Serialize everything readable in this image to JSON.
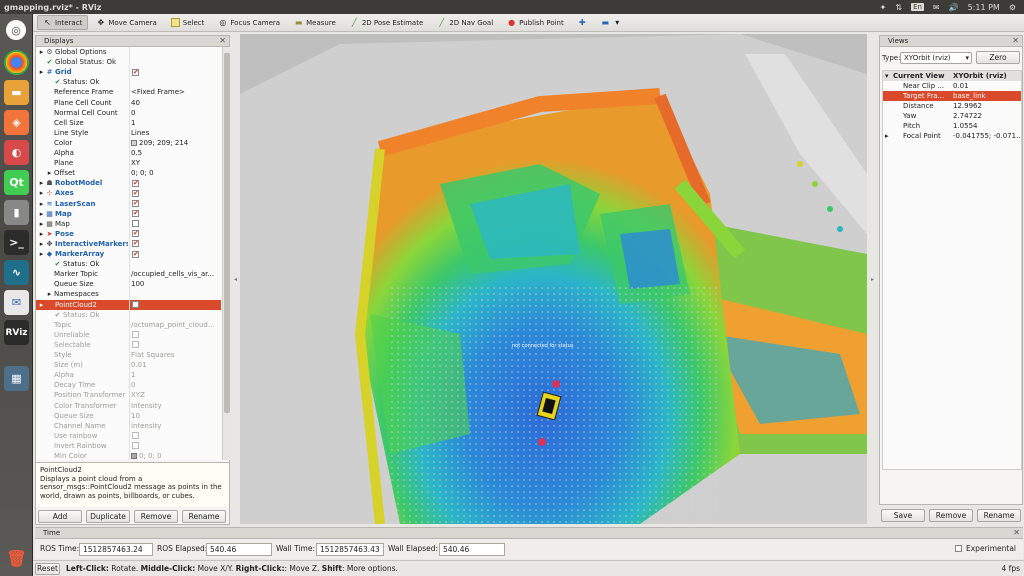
{
  "window": {
    "title": "gmapping.rviz* - RViz"
  },
  "tray": {
    "keyboard": "En",
    "clock": "5:11 PM"
  },
  "launcher": {
    "qt_label": "Qt",
    "rviz_label": "RViz"
  },
  "toolbar": {
    "tools": [
      {
        "label": "Interact",
        "icon": "interact-icon"
      },
      {
        "label": "Move Camera",
        "icon": "move-camera-icon"
      },
      {
        "label": "Select",
        "icon": "select-icon"
      },
      {
        "label": "Focus Camera",
        "icon": "focus-camera-icon"
      },
      {
        "label": "Measure",
        "icon": "measure-icon"
      },
      {
        "label": "2D Pose Estimate",
        "icon": "pose-estimate-icon"
      },
      {
        "label": "2D Nav Goal",
        "icon": "nav-goal-icon"
      },
      {
        "label": "Publish Point",
        "icon": "publish-point-icon"
      }
    ]
  },
  "displays": {
    "title": "Displays",
    "rows": [
      {
        "label": "Global Options",
        "value": ""
      },
      {
        "label": "Global Status: Ok",
        "value": ""
      },
      {
        "label": "Grid",
        "value": ""
      },
      {
        "label": "Status: Ok",
        "value": ""
      },
      {
        "label": "Reference Frame",
        "value": "<Fixed Frame>"
      },
      {
        "label": "Plane Cell Count",
        "value": "40"
      },
      {
        "label": "Normal Cell Count",
        "value": "0"
      },
      {
        "label": "Cell Size",
        "value": "1"
      },
      {
        "label": "Line Style",
        "value": "Lines"
      },
      {
        "label": "Color",
        "value": "209; 209; 214"
      },
      {
        "label": "Alpha",
        "value": "0.5"
      },
      {
        "label": "Plane",
        "value": "XY"
      },
      {
        "label": "Offset",
        "value": "0; 0; 0"
      },
      {
        "label": "RobotModel",
        "value": ""
      },
      {
        "label": "Axes",
        "value": ""
      },
      {
        "label": "LaserScan",
        "value": ""
      },
      {
        "label": "Map",
        "value": ""
      },
      {
        "label": "Map",
        "value": ""
      },
      {
        "label": "Pose",
        "value": ""
      },
      {
        "label": "InteractiveMarkers",
        "value": ""
      },
      {
        "label": "MarkerArray",
        "value": ""
      },
      {
        "label": "Status: Ok",
        "value": ""
      },
      {
        "label": "Marker Topic",
        "value": "/occupied_cells_vis_ar..."
      },
      {
        "label": "Queue Size",
        "value": "100"
      },
      {
        "label": "Namespaces",
        "value": ""
      },
      {
        "label": "PointCloud2",
        "value": ""
      },
      {
        "label": "Status: Ok",
        "value": ""
      },
      {
        "label": "Topic",
        "value": "/octomap_point_cloud..."
      },
      {
        "label": "Unreliable",
        "value": ""
      },
      {
        "label": "Selectable",
        "value": ""
      },
      {
        "label": "Style",
        "value": "Flat Squares"
      },
      {
        "label": "Size (m)",
        "value": "0.01"
      },
      {
        "label": "Alpha",
        "value": "1"
      },
      {
        "label": "Decay Time",
        "value": "0"
      },
      {
        "label": "Position Transformer",
        "value": "XYZ"
      },
      {
        "label": "Color Transformer",
        "value": "Intensity"
      },
      {
        "label": "Queue Size",
        "value": "10"
      },
      {
        "label": "Channel Name",
        "value": "intensity"
      },
      {
        "label": "Use rainbow",
        "value": ""
      },
      {
        "label": "Invert Rainbow",
        "value": ""
      },
      {
        "label": "Min Color",
        "value": "0; 0; 0"
      }
    ],
    "help_title": "PointCloud2",
    "help_text": "Displays a point cloud from a sensor_msgs::PointCloud2 message as points in the world, drawn as points, billboards, or cubes.",
    "buttons": {
      "add": "Add",
      "duplicate": "Duplicate",
      "remove": "Remove",
      "rename": "Rename"
    }
  },
  "viewport": {
    "overlay_text": "not connected for status"
  },
  "views": {
    "title": "Views",
    "type_label": "Type:",
    "type_value": "XYOrbit (rviz)",
    "zero_label": "Zero",
    "rows": [
      {
        "label": "Current View",
        "value": "XYOrbit (rviz)"
      },
      {
        "label": "Near Clip ...",
        "value": "0.01"
      },
      {
        "label": "Target Fra...",
        "value": "base_link"
      },
      {
        "label": "Distance",
        "value": "12.9962"
      },
      {
        "label": "Yaw",
        "value": "2.74722"
      },
      {
        "label": "Pitch",
        "value": "1.0554"
      },
      {
        "label": "Focal Point",
        "value": "-0.041755; -0.071..."
      }
    ],
    "buttons": {
      "save": "Save",
      "remove": "Remove",
      "rename": "Rename"
    }
  },
  "time": {
    "title": "Time",
    "ros_time_label": "ROS Time:",
    "ros_time": "1512857463.24",
    "ros_elapsed_label": "ROS Elapsed:",
    "ros_elapsed": "540.46",
    "wall_time_label": "Wall Time:",
    "wall_time": "1512857463.43",
    "wall_elapsed_label": "Wall Elapsed:",
    "wall_elapsed": "540.46",
    "experimental_label": "Experimental"
  },
  "statusbar": {
    "reset_label": "Reset",
    "hint_left_click": "Left-Click:",
    "hint_left_text": " Rotate. ",
    "hint_middle_click": "Middle-Click:",
    "hint_middle_text": " Move X/Y. ",
    "hint_right_click": "Right-Click:",
    "hint_right_text": ": Move Z. ",
    "hint_shift": "Shift",
    "hint_shift_text": ": More options.",
    "fps": "4 fps"
  },
  "colors": {
    "selection": "#d84a2b",
    "ubuntu_bar": "#3c3b37",
    "link_blue": "#1f5fb0"
  }
}
